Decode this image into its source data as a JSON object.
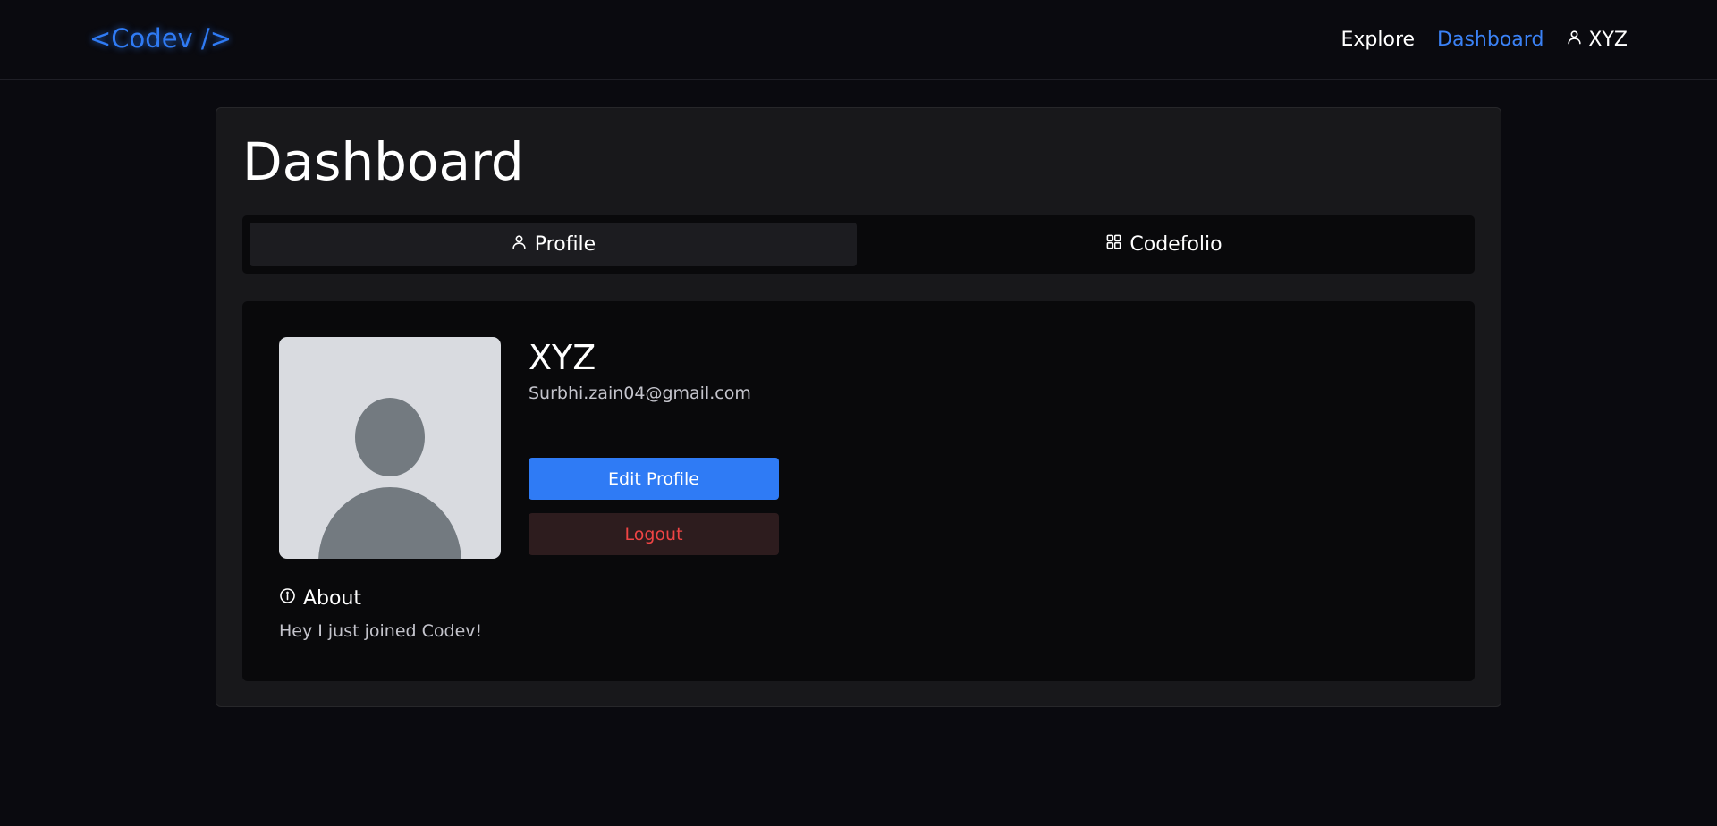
{
  "navbar": {
    "logo": "<Codev />",
    "links": [
      {
        "label": "Explore",
        "active": false
      },
      {
        "label": "Dashboard",
        "active": true
      }
    ],
    "user": {
      "label": "XYZ",
      "icon": "user-icon"
    }
  },
  "dashboard": {
    "title": "Dashboard",
    "tabs": [
      {
        "label": "Profile",
        "icon": "user-icon",
        "active": true
      },
      {
        "label": "Codefolio",
        "icon": "grid-icon",
        "active": false
      }
    ]
  },
  "profile": {
    "name": "XYZ",
    "email": "Surbhi.zain04@gmail.com",
    "avatar_icon": "default-avatar-icon",
    "edit_label": "Edit Profile",
    "logout_label": "Logout",
    "about_heading": "About",
    "about_icon": "info-icon",
    "about_text": "Hey I just joined Codev!"
  },
  "colors": {
    "accent": "#2f7bf5",
    "danger": "#ef4444",
    "background": "#0a0a0f",
    "card": "#18181b"
  }
}
